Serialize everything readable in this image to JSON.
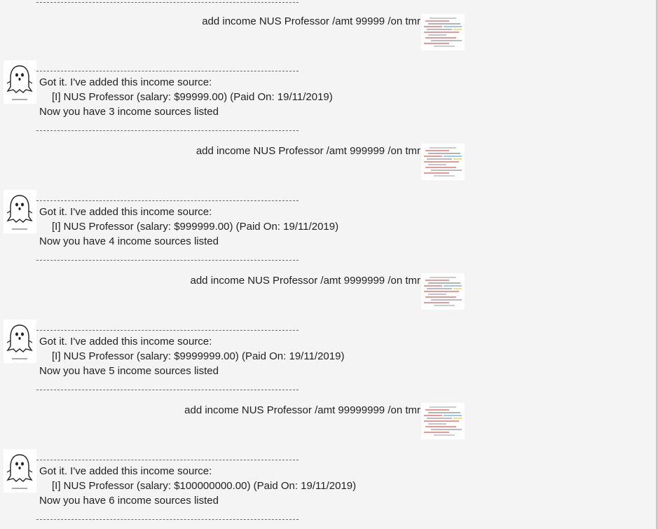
{
  "separator": "------------------------------------------------------------",
  "conversation": {
    "user_messages": [
      "add income NUS Professor /amt 99999 /on tmr",
      "add income NUS Professor /amt 999999 /on tmr",
      "add income NUS Professor /amt 9999999 /on tmr",
      "add income NUS Professor /amt 99999999 /on tmr"
    ],
    "bot_replies": [
      {
        "line1": "Got it. I've added this income source:",
        "line2": "[I] NUS Professor (salary: $99999.00) (Paid On: 19/11/2019)",
        "line3": "Now you have 3 income sources listed"
      },
      {
        "line1": "Got it. I've added this income source:",
        "line2": "[I] NUS Professor (salary: $999999.00) (Paid On: 19/11/2019)",
        "line3": "Now you have 4 income sources listed"
      },
      {
        "line1": "Got it. I've added this income source:",
        "line2": "[I] NUS Professor (salary: $9999999.00) (Paid On: 19/11/2019)",
        "line3": "Now you have 5 income sources listed"
      },
      {
        "line1": "Got it. I've added this income source:",
        "line2": "[I] NUS Professor (salary: $100000000.00) (Paid On: 19/11/2019)",
        "line3": "Now you have 6 income sources listed"
      }
    ]
  },
  "icons": {
    "bot_avatar": "ghost-icon",
    "user_avatar": "user-avatar-image"
  }
}
